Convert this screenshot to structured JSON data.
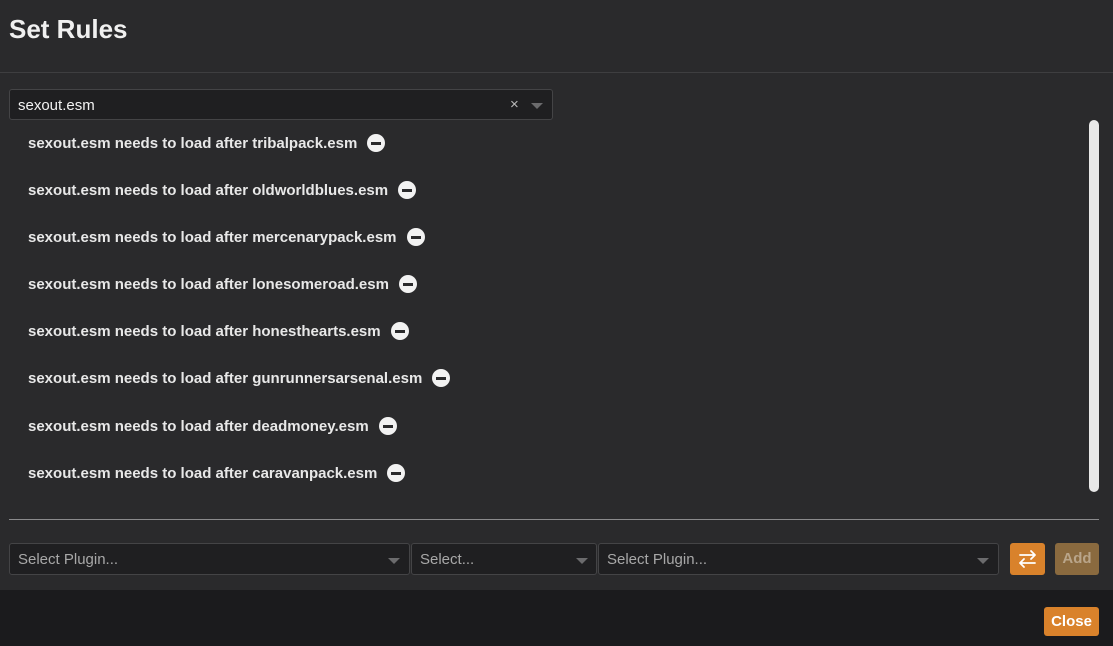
{
  "dialog": {
    "title": "Set Rules"
  },
  "plugin_select": {
    "value": "sexout.esm",
    "clear_glyph": "×"
  },
  "rules": [
    {
      "text": "sexout.esm needs to load after tribalpack.esm"
    },
    {
      "text": "sexout.esm needs to load after oldworldblues.esm"
    },
    {
      "text": "sexout.esm needs to load after mercenarypack.esm"
    },
    {
      "text": "sexout.esm needs to load after lonesomeroad.esm"
    },
    {
      "text": "sexout.esm needs to load after honesthearts.esm"
    },
    {
      "text": "sexout.esm needs to load after gunrunnersarsenal.esm"
    },
    {
      "text": "sexout.esm needs to load after deadmoney.esm"
    },
    {
      "text": "sexout.esm needs to load after caravanpack.esm"
    }
  ],
  "add_rule": {
    "source_placeholder": "Select Plugin...",
    "type_placeholder": "Select...",
    "target_placeholder": "Select Plugin...",
    "swap_icon": "swap-arrows-icon",
    "add_label": "Add"
  },
  "footer": {
    "close_label": "Close"
  },
  "colors": {
    "accent": "#d9822b",
    "background": "#2a2a2c",
    "footer": "#1b1b1d"
  }
}
